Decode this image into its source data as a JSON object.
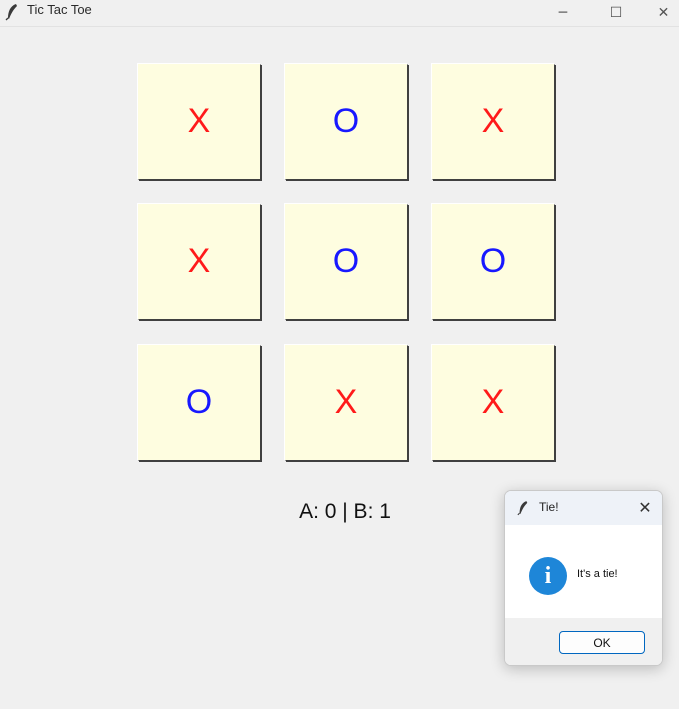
{
  "window": {
    "title": "Tic Tac Toe",
    "controls": {
      "minimize": "─",
      "maximize": "☐",
      "close": "✕"
    }
  },
  "board": {
    "cells": [
      {
        "mark": "X"
      },
      {
        "mark": "O"
      },
      {
        "mark": "X"
      },
      {
        "mark": "X"
      },
      {
        "mark": "O"
      },
      {
        "mark": "O"
      },
      {
        "mark": "O"
      },
      {
        "mark": "X"
      },
      {
        "mark": "X"
      }
    ],
    "colors": {
      "X": "#ff1a1a",
      "O": "#1818ff",
      "cell_bg": "#fefde0"
    }
  },
  "score": {
    "text": "A: 0 | B: 1"
  },
  "dialog": {
    "title": "Tie!",
    "close": "✕",
    "icon": "info-icon",
    "icon_glyph": "i",
    "message": "It's a tie!",
    "ok_label": "OK"
  }
}
